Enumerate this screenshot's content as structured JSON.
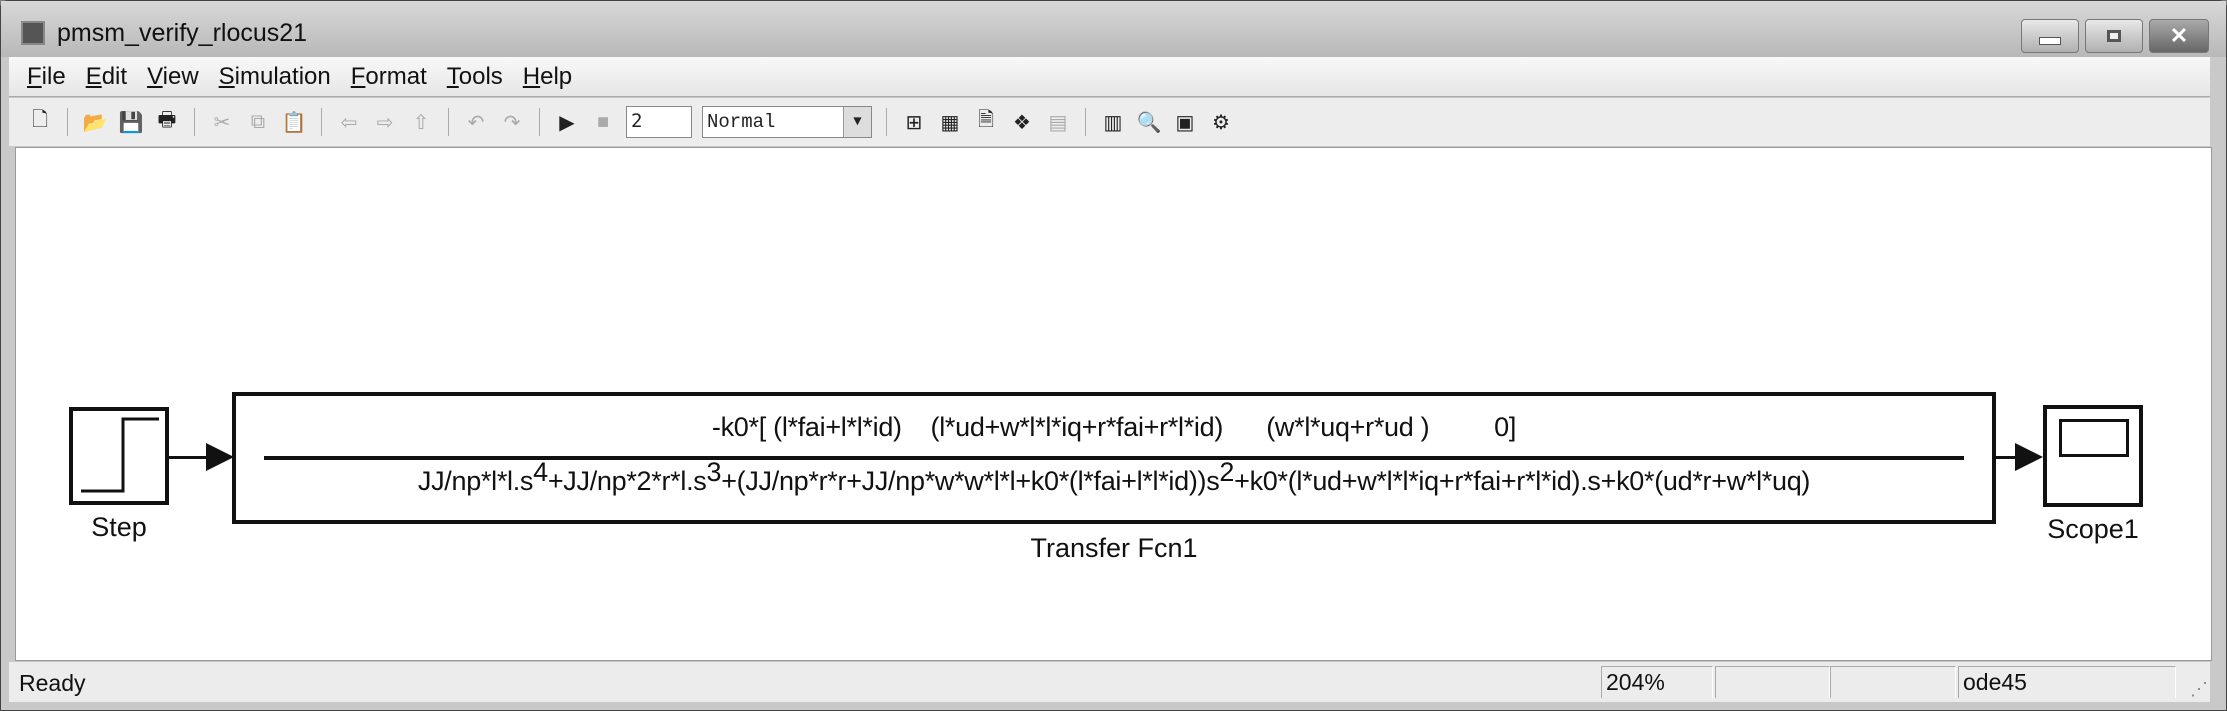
{
  "window": {
    "title": "pmsm_verify_rlocus21",
    "controls": [
      "minimize",
      "maximize",
      "close"
    ]
  },
  "menu": [
    "File",
    "Edit",
    "View",
    "Simulation",
    "Format",
    "Tools",
    "Help"
  ],
  "toolbar": {
    "stop_time": "2",
    "sim_mode": "Normal"
  },
  "blocks": {
    "step": {
      "label": "Step"
    },
    "transfer_fcn": {
      "label": "Transfer Fcn1",
      "numerator": "-k0*[ (l*fai+l*l*id)    (l*ud+w*l*l*iq+r*fai+r*l*id)      (w*l*uq+r*ud )         0]",
      "den_part1": "JJ/np*l*l.s",
      "den_exp1": "4",
      "den_part2": "+JJ/np*2*r*l.s",
      "den_exp2": "3",
      "den_part3": "+(JJ/np*r*r+JJ/np*w*w*l*l+k0*(l*fai+l*l*id))s",
      "den_exp3": "2",
      "den_part4": "+k0*(l*ud+w*l*l*iq+r*fai+r*l*id).s+k0*(ud*r+w*l*uq)"
    },
    "scope": {
      "label": "Scope1"
    }
  },
  "status": {
    "text": "Ready",
    "zoom": "204%",
    "field2": "",
    "field3": "",
    "solver": "ode45"
  }
}
